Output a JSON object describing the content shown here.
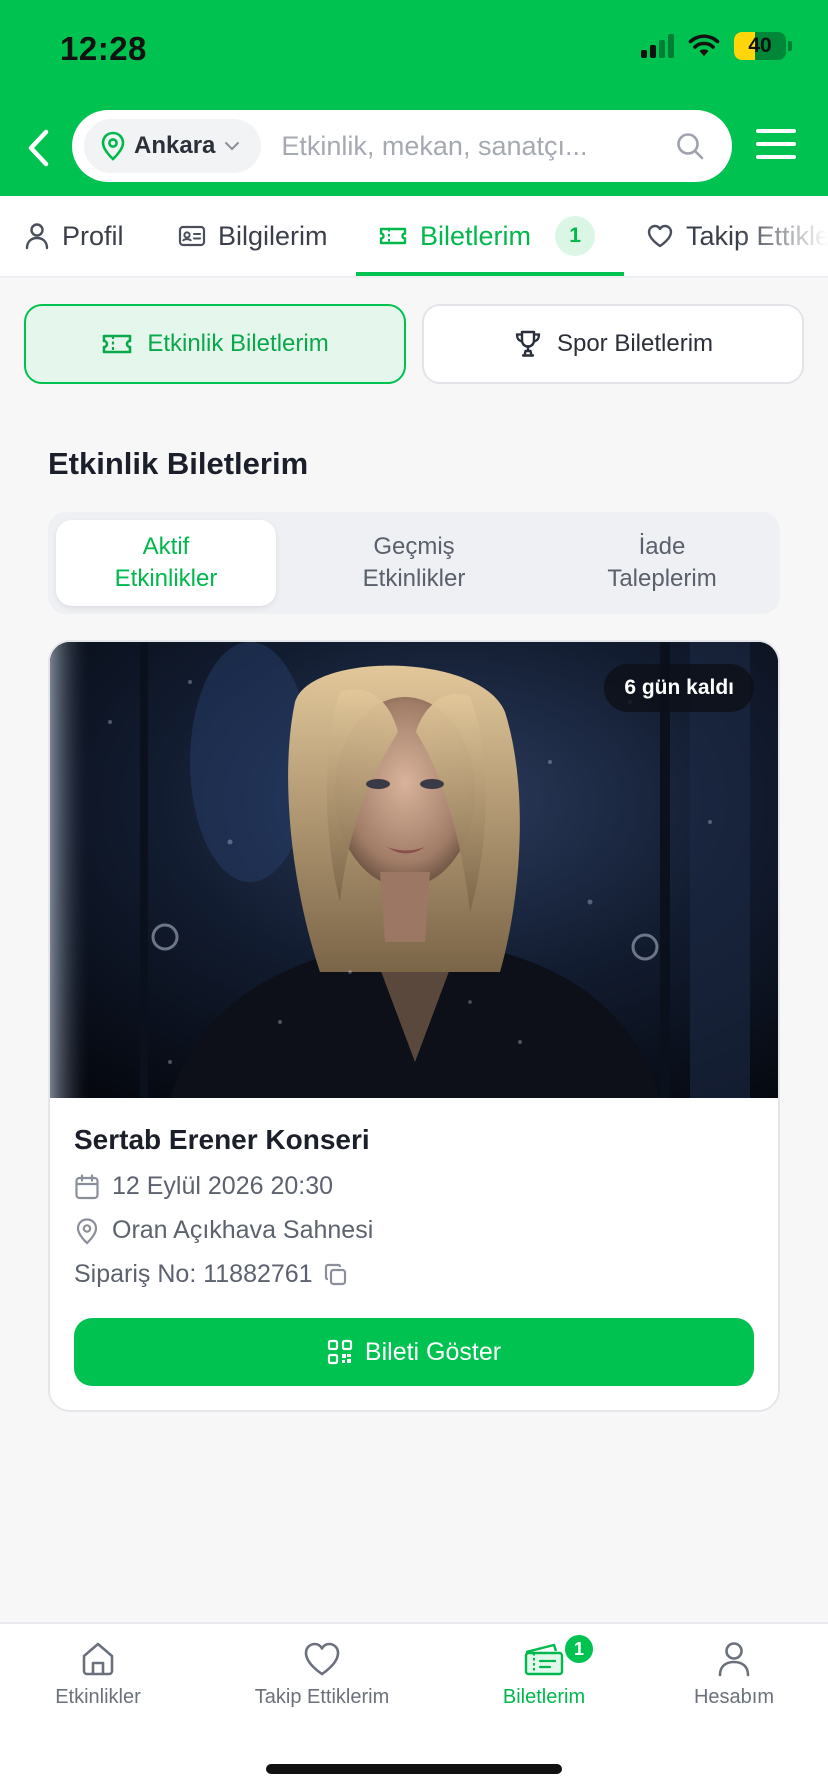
{
  "status_bar": {
    "time": "12:28",
    "battery": "40",
    "battery_level": 0.4
  },
  "header": {
    "city": "Ankara",
    "search_placeholder": "Etkinlik, mekan, sanatçı..."
  },
  "profile_tabs": [
    {
      "label": "Profil",
      "icon": "user-icon"
    },
    {
      "label": "Bilgilerim",
      "icon": "id-card-icon"
    },
    {
      "label": "Biletlerim",
      "icon": "ticket-icon",
      "badge": "1",
      "active": true
    },
    {
      "label": "Takip Ettiklerim",
      "icon": "heart-icon"
    }
  ],
  "categories": {
    "event": "Etkinlik Biletlerim",
    "sport": "Spor Biletlerim"
  },
  "section_title": "Etkinlik Biletlerim",
  "segments": [
    {
      "line1": "Aktif",
      "line2": "Etkinlikler",
      "active": true
    },
    {
      "line1": "Geçmiş",
      "line2": "Etkinlikler"
    },
    {
      "line1": "İade",
      "line2": "Taleplerim"
    }
  ],
  "event": {
    "days_left": "6 gün kaldı",
    "title": "Sertab Erener Konseri",
    "datetime": "12 Eylül 2026 20:30",
    "venue": "Oran Açıkhava Sahnesi",
    "order": "Sipariş No: 11882761",
    "show_ticket": "Bileti Göster"
  },
  "bottom_nav": [
    {
      "label": "Etkinlikler",
      "icon": "home-icon"
    },
    {
      "label": "Takip Ettiklerim",
      "icon": "heart-icon"
    },
    {
      "label": "Biletlerim",
      "icon": "tickets-icon",
      "badge": "1",
      "active": true
    },
    {
      "label": "Hesabım",
      "icon": "user-icon"
    }
  ],
  "colors": {
    "brand": "#00c250",
    "active_text": "#00b84c"
  }
}
